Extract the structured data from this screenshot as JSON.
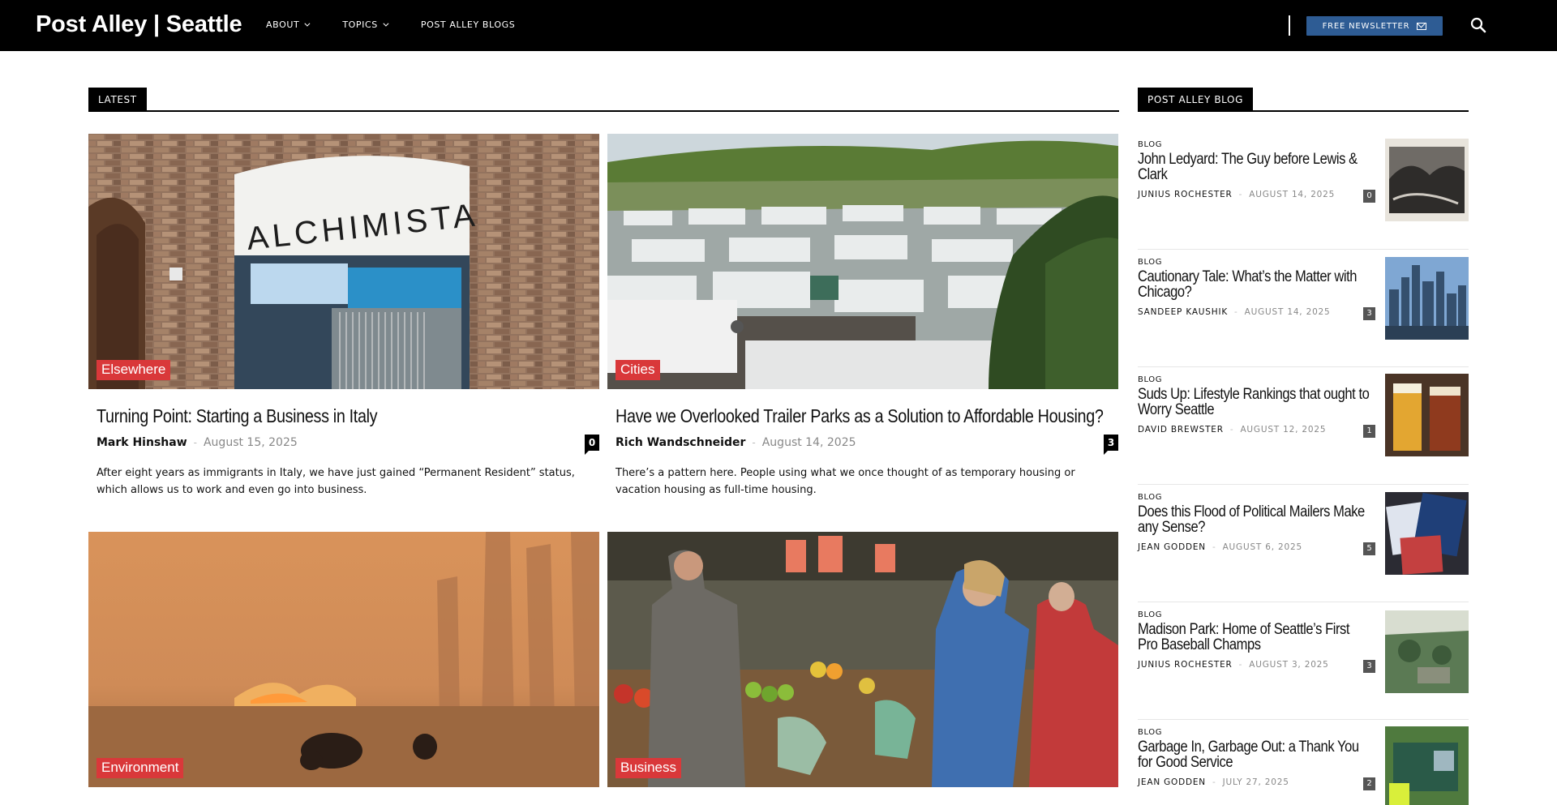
{
  "header": {
    "brand": "Post Alley | Seattle",
    "nav": [
      {
        "label": "ABOUT",
        "has_dropdown": true
      },
      {
        "label": "TOPICS",
        "has_dropdown": true
      },
      {
        "label": "POST ALLEY BLOGS",
        "has_dropdown": false
      }
    ],
    "newsletter_label": "FREE NEWSLETTER",
    "newsletter_color": "#2e5c94"
  },
  "latest": {
    "heading": "LATEST",
    "articles": [
      {
        "category": "Elsewhere",
        "title": "Turning Point: Starting a Business in Italy",
        "author": "Mark Hinshaw",
        "date": "August 15, 2025",
        "comments": "0",
        "excerpt": "After eight years as immigrants in Italy, we have just gained “Permanent Resident” status, which allows us to work and even go into business."
      },
      {
        "category": "Cities",
        "title": "Have we Overlooked Trailer Parks as a Solution to Affordable Housing?",
        "author": "Rich Wandschneider",
        "date": "August 14, 2025",
        "comments": "3",
        "excerpt": "There’s a pattern here. People using what we once thought of as temporary housing or vacation housing as full-time housing."
      },
      {
        "category": "Environment"
      },
      {
        "category": "Business"
      }
    ]
  },
  "sidebar": {
    "heading": "POST ALLEY BLOG",
    "items": [
      {
        "kicker": "BLOG",
        "title": "John Ledyard: The Guy before Lewis & Clark",
        "author": "JUNIUS ROCHESTER",
        "date": "AUGUST 14, 2025",
        "comments": "0"
      },
      {
        "kicker": "BLOG",
        "title": "Cautionary Tale: What’s the Matter with Chicago?",
        "author": "SANDEEP KAUSHIK",
        "date": "AUGUST 14, 2025",
        "comments": "3"
      },
      {
        "kicker": "BLOG",
        "title": "Suds Up: Lifestyle Rankings that ought to Worry Seattle",
        "author": "DAVID BREWSTER",
        "date": "AUGUST 12, 2025",
        "comments": "1"
      },
      {
        "kicker": "BLOG",
        "title": "Does this Flood of Political Mailers Make any Sense?",
        "author": "JEAN GODDEN",
        "date": "AUGUST 6, 2025",
        "comments": "5"
      },
      {
        "kicker": "BLOG",
        "title": "Madison Park: Home of Seattle’s First Pro Baseball Champs",
        "author": "JUNIUS ROCHESTER",
        "date": "AUGUST 3, 2025",
        "comments": "3"
      },
      {
        "kicker": "BLOG",
        "title": "Garbage In, Garbage Out: a Thank You for Good Service",
        "author": "JEAN GODDEN",
        "date": "JULY 27, 2025",
        "comments": "2"
      }
    ]
  },
  "colors": {
    "badge_red": "#d9383a",
    "header_bg": "#000000"
  },
  "icons": [
    "search-icon",
    "mail-icon",
    "chevron-down-icon"
  ]
}
